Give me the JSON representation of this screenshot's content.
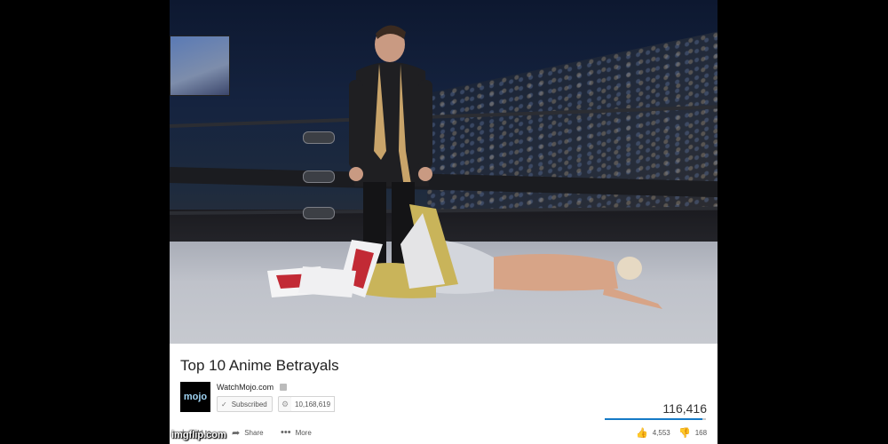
{
  "video": {
    "title": "Top 10 Anime Betrayals"
  },
  "channel": {
    "name": "WatchMojo.com",
    "logo_text": "mojo",
    "subscribe_label": "Subscribed",
    "subscriber_count": "10,168,619"
  },
  "stats": {
    "views": "116,416",
    "likes": "4,553",
    "dislikes": "168",
    "like_ratio": 0.964
  },
  "actions": {
    "add_to": "Add to",
    "share": "Share",
    "more": "More"
  },
  "watermark": "imgflip.com",
  "icons": [
    "verified-icon",
    "check-icon",
    "gear-icon",
    "plus-icon",
    "share-icon",
    "more-icon",
    "thumbs-up-icon",
    "thumbs-down-icon"
  ],
  "colors": {
    "like_bar": "#167ac6",
    "logo_text": "#9fd3f3"
  }
}
